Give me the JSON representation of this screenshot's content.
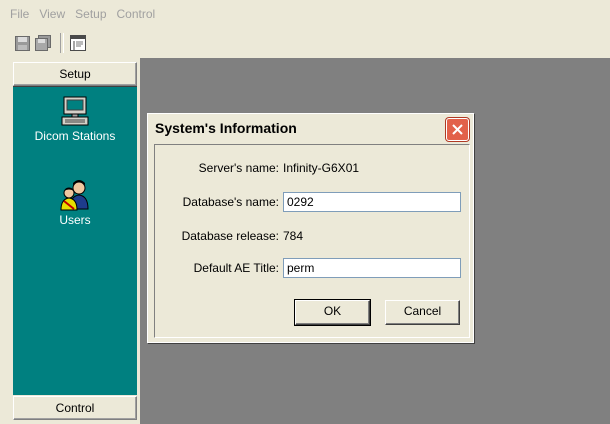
{
  "menubar": {
    "items": [
      {
        "label": "File"
      },
      {
        "label": "View"
      },
      {
        "label": "Setup"
      },
      {
        "label": "Control"
      }
    ]
  },
  "toolbar": {
    "buttons": [
      {
        "icon": "save-icon"
      },
      {
        "icon": "save-all-icon"
      },
      {
        "icon": "properties-icon"
      }
    ]
  },
  "sidebar": {
    "setup_label": "Setup",
    "control_label": "Control",
    "items": [
      {
        "label": "Dicom Stations",
        "icon": "computer-icon"
      },
      {
        "label": "Users",
        "icon": "users-icon"
      }
    ]
  },
  "dialog": {
    "title": "System's Information",
    "server_name_label": "Server's name:",
    "server_name_value": "Infinity-G6X01",
    "database_name_label": "Database's name:",
    "database_name_value": "0292",
    "database_release_label": "Database release:",
    "database_release_value": "784",
    "default_ae_label": "Default AE Title:",
    "default_ae_value": "perm",
    "ok_label": "OK",
    "cancel_label": "Cancel"
  },
  "colors": {
    "sidebar_bg": "#008080",
    "workspace_bg": "#808080",
    "window_bg": "#ece9d8",
    "close_button": "#e2614a"
  }
}
